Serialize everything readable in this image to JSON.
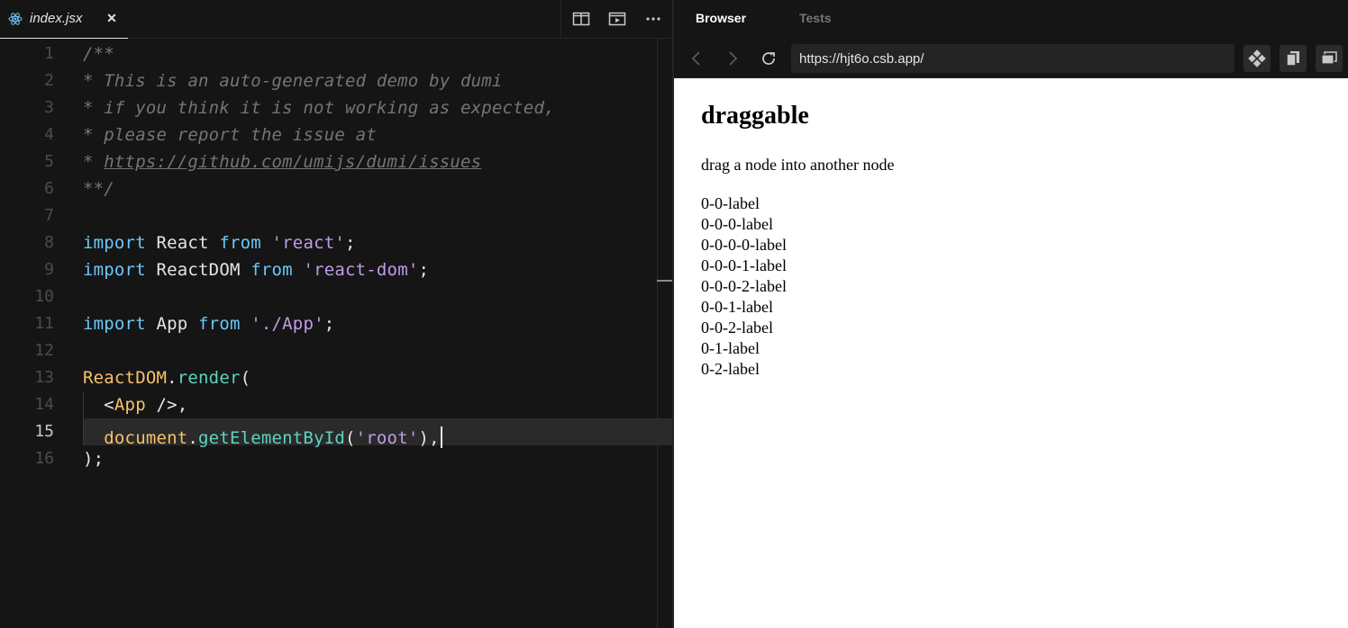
{
  "editor": {
    "tab": {
      "icon": "react-icon",
      "label": "index.jsx",
      "close_icon": "close-icon"
    },
    "actions": [
      "split-editor-icon",
      "open-preview-icon",
      "more-icon"
    ],
    "active_line": 15,
    "lines": [
      {
        "n": "1",
        "tokens": [
          {
            "t": "/**",
            "c": "c-comment"
          }
        ]
      },
      {
        "n": "2",
        "tokens": [
          {
            "t": "* This is an auto-generated demo by dumi",
            "c": "c-comment"
          }
        ]
      },
      {
        "n": "3",
        "tokens": [
          {
            "t": "* if you think it is not working as expected,",
            "c": "c-comment"
          }
        ]
      },
      {
        "n": "4",
        "tokens": [
          {
            "t": "* please report the issue at",
            "c": "c-comment"
          }
        ]
      },
      {
        "n": "5",
        "tokens": [
          {
            "t": "* ",
            "c": "c-comment"
          },
          {
            "t": "https://github.com/umijs/dumi/issues",
            "c": "c-link"
          }
        ]
      },
      {
        "n": "6",
        "tokens": [
          {
            "t": "**/",
            "c": "c-comment"
          }
        ]
      },
      {
        "n": "7",
        "tokens": []
      },
      {
        "n": "8",
        "tokens": [
          {
            "t": "import",
            "c": "c-kw"
          },
          {
            "t": " React ",
            "c": "c-id"
          },
          {
            "t": "from",
            "c": "c-kw"
          },
          {
            "t": " ",
            "c": "c-id"
          },
          {
            "t": "'react'",
            "c": "c-str"
          },
          {
            "t": ";",
            "c": "c-punc"
          }
        ]
      },
      {
        "n": "9",
        "tokens": [
          {
            "t": "import",
            "c": "c-kw"
          },
          {
            "t": " ReactDOM ",
            "c": "c-id"
          },
          {
            "t": "from",
            "c": "c-kw"
          },
          {
            "t": " ",
            "c": "c-id"
          },
          {
            "t": "'react-dom'",
            "c": "c-str"
          },
          {
            "t": ";",
            "c": "c-punc"
          }
        ]
      },
      {
        "n": "10",
        "tokens": []
      },
      {
        "n": "11",
        "tokens": [
          {
            "t": "import",
            "c": "c-kw"
          },
          {
            "t": " App ",
            "c": "c-id"
          },
          {
            "t": "from",
            "c": "c-kw"
          },
          {
            "t": " ",
            "c": "c-id"
          },
          {
            "t": "'./App'",
            "c": "c-str"
          },
          {
            "t": ";",
            "c": "c-punc"
          }
        ]
      },
      {
        "n": "12",
        "tokens": []
      },
      {
        "n": "13",
        "tokens": [
          {
            "t": "ReactDOM",
            "c": "c-obj"
          },
          {
            "t": ".",
            "c": "c-punc"
          },
          {
            "t": "render",
            "c": "c-fn"
          },
          {
            "t": "(",
            "c": "c-punc"
          }
        ]
      },
      {
        "n": "14",
        "tokens": [
          {
            "t": "  <",
            "c": "c-punc"
          },
          {
            "t": "App",
            "c": "c-obj"
          },
          {
            "t": " />,",
            "c": "c-punc"
          }
        ]
      },
      {
        "n": "15",
        "tokens": [
          {
            "t": "  ",
            "c": "c-punc"
          },
          {
            "t": "document",
            "c": "c-obj"
          },
          {
            "t": ".",
            "c": "c-punc"
          },
          {
            "t": "getElementById",
            "c": "c-fn"
          },
          {
            "t": "(",
            "c": "c-punc"
          },
          {
            "t": "'root'",
            "c": "c-str"
          },
          {
            "t": "),",
            "c": "c-punc"
          }
        ]
      },
      {
        "n": "16",
        "tokens": [
          {
            "t": ");",
            "c": "c-punc"
          }
        ]
      }
    ]
  },
  "browser": {
    "tabs": [
      {
        "label": "Browser",
        "active": true
      },
      {
        "label": "Tests",
        "active": false
      }
    ],
    "nav": [
      "back-icon",
      "forward-icon",
      "reload-icon"
    ],
    "url": "https://hjt6o.csb.app/",
    "toolbar_buttons": [
      "devtools-icon",
      "open-new-window-icon",
      "open-in-sandbox-icon"
    ],
    "page": {
      "title": "draggable",
      "description": "drag a node into another node",
      "tree_items": [
        "0-0-label",
        "0-0-0-label",
        "0-0-0-0-label",
        "0-0-0-1-label",
        "0-0-0-2-label",
        "0-0-1-label",
        "0-0-2-label",
        "0-1-label",
        "0-2-label"
      ]
    }
  },
  "colors": {
    "editor_bg": "#151515",
    "keyword": "#6cc7f6",
    "string": "#bf9ce9",
    "function": "#5ed4c0",
    "object": "#f7c16c",
    "comment": "#757575"
  }
}
